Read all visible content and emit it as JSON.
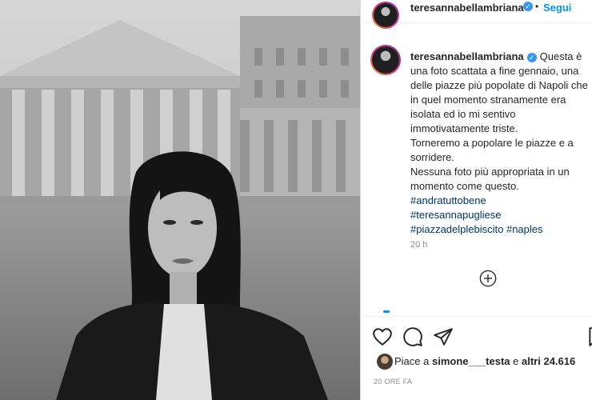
{
  "post": {
    "username": "teresannabellambriana",
    "follow_label": "Segui",
    "caption_text": "Questa è una foto scattata a fine gennaio, una delle piazze più popolate di Napoli che in quel momento stranamente era isolata ed io mi sentivo immotivatamente triste.",
    "caption_line2": "Torneremo a popolare le piazze e a sorridere.",
    "caption_line3": "Nessuna foto più appropriata in un momento come questo.",
    "hashtags": [
      "#andratuttobene",
      "#teresannapugliese",
      "#piazzadelplebiscito #naples"
    ],
    "time_ago": "20 h",
    "likes_prefix": "Piace a ",
    "likes_user": "simone___testa",
    "likes_middle": " e ",
    "likes_others": "altri 24.616",
    "date_label": "20 ORE FA"
  },
  "icons": {
    "verified": "verified-badge-icon",
    "like": "heart-icon",
    "comment": "comment-icon",
    "share": "paper-plane-icon",
    "save": "bookmark-icon",
    "load_more": "plus-circle-icon"
  },
  "colors": {
    "link": "#0095f6",
    "hashtag": "#00376b",
    "muted": "#8e8e8e",
    "text": "#262626"
  }
}
